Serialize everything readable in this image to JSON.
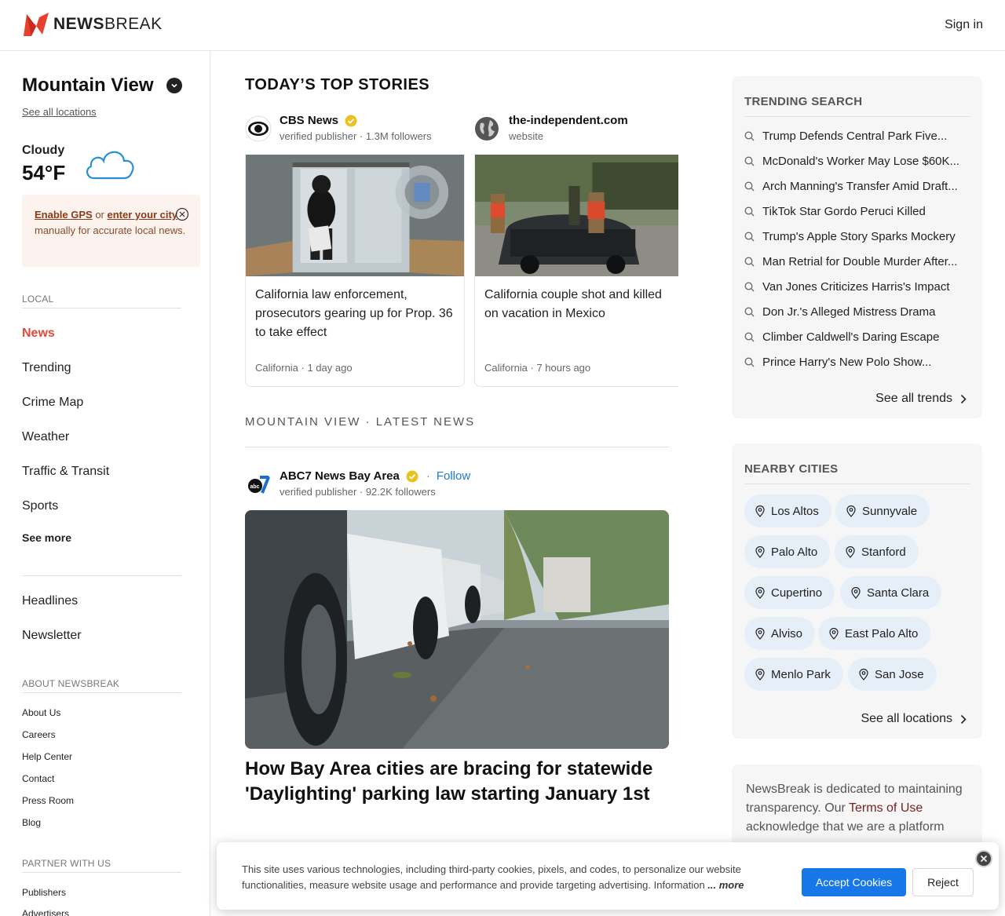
{
  "header": {
    "brand": "NEWSBREAK",
    "brand_prefix": "NEWS",
    "brand_suffix": "BREAK",
    "signin": "Sign in"
  },
  "sidebar": {
    "city": "Mountain View",
    "see_all_locations": "See all locations",
    "weather": {
      "condition": "Cloudy",
      "temp": "54°F"
    },
    "gps": {
      "enable": "Enable GPS",
      "or": " or ",
      "enter": "enter your city",
      "rest": " manually for accurate local news."
    },
    "local_label": "LOCAL",
    "local_items": [
      "News",
      "Trending",
      "Crime Map",
      "Weather",
      "Traffic & Transit",
      "Sports"
    ],
    "see_more": "See more",
    "extra_items": [
      "Headlines",
      "Newsletter"
    ],
    "about_label": "ABOUT NEWSBREAK",
    "about_items": [
      "About Us",
      "Careers",
      "Help Center",
      "Contact",
      "Press Room",
      "Blog"
    ],
    "partner_label": "PARTNER WITH US",
    "partner_items": [
      "Publishers",
      "Advertisers"
    ]
  },
  "top_stories": {
    "heading": "TODAY’S TOP STORIES",
    "cards": [
      {
        "publisher": "CBS News",
        "meta": "verified publisher · 1.3M followers",
        "title": "California law enforcement, prosecutors gearing up for Prop. 36 to take effect",
        "footer": "California · 1 day ago"
      },
      {
        "publisher": "the-independent.com",
        "meta": "website",
        "title": "California couple shot and killed on vacation in Mexico",
        "footer": "California · 7 hours ago"
      }
    ]
  },
  "latest": {
    "heading": "MOUNTAIN VIEW · LATEST NEWS",
    "publisher": "ABC7 News Bay Area",
    "follow": "Follow",
    "separator": "·",
    "meta": "verified publisher · 92.2K followers",
    "title": "How Bay Area cities are bracing for statewide 'Daylighting' parking law starting January 1st"
  },
  "trending": {
    "heading": "TRENDING SEARCH",
    "items": [
      "Trump Defends Central Park Five...",
      "McDonald's Worker May Lose $60K...",
      "Arch Manning's Transfer Amid Draft...",
      "TikTok Star Gordo Peruci Killed",
      "Trump's Apple Story Sparks Mockery",
      "Man Retrial for Double Murder After...",
      "Van Jones Criticizes Harris's Impact",
      "Don Jr.'s Alleged Mistress Drama",
      "Climber Caldwell's Daring Escape",
      "Prince Harry's New Polo Show..."
    ],
    "see_all": "See all trends"
  },
  "nearby": {
    "heading": "NEARBY CITIES",
    "cities": [
      "Los Altos",
      "Sunnyvale",
      "Palo Alto",
      "Stanford",
      "Cupertino",
      "Santa Clara",
      "Alviso",
      "East Palo Alto",
      "Menlo Park",
      "San Jose"
    ],
    "see_all": "See all locations"
  },
  "transparency": {
    "pre": "NewsBreak is dedicated to maintaining transparency. Our ",
    "terms": "Terms of Use",
    "post": " acknowledge that we are a platform"
  },
  "cookie": {
    "text": "This site uses various technologies, including third-party cookies, pixels, and codes, to personalize our website functionalities, measure website usage and performance and provide targeting advertising. Information",
    "more": "... more",
    "accept": "Accept Cookies",
    "reject": "Reject"
  },
  "colors": {
    "accent": "#e04b3a",
    "link": "#1a7ad9",
    "accept": "#1877e8",
    "chip": "#e6eef8"
  }
}
